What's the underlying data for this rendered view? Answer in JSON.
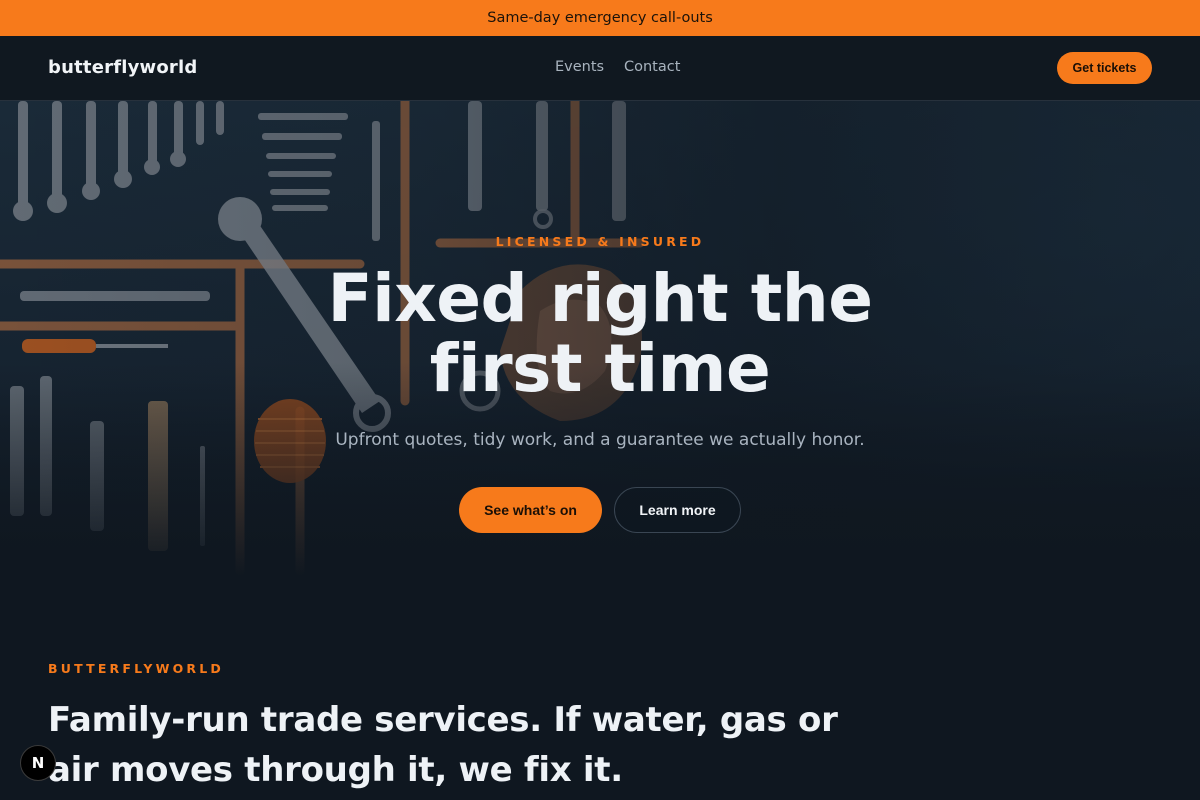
{
  "announcement": {
    "text": "Same-day emergency call-outs"
  },
  "header": {
    "logo": "butterflyworld",
    "nav": [
      {
        "label": "Events"
      },
      {
        "label": "Contact"
      }
    ],
    "cta_label": "Get tickets"
  },
  "hero": {
    "eyebrow": "LICENSED & INSURED",
    "title": "Fixed right the first time",
    "subtitle": "Upfront quotes, tidy work, and a guarantee we actually honor.",
    "primary_label": "See what’s on",
    "secondary_label": "Learn more"
  },
  "about": {
    "eyebrow": "BUTTERFLYWORLD",
    "heading": "Family-run trade services. If water, gas or air moves through it, we fix it."
  },
  "badge": {
    "letter": "N"
  },
  "colors": {
    "accent": "#f77a1b",
    "background": "#0f1720",
    "header_bg": "#101820"
  }
}
